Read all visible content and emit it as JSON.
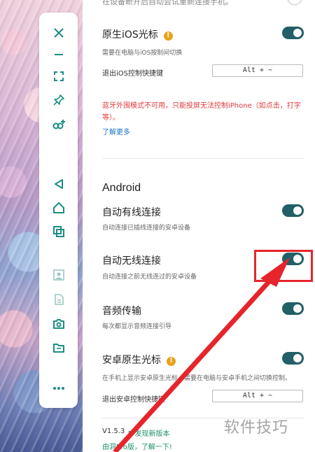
{
  "top_cut_text": "在设备断开后自动尝试重新连接手机。",
  "ios": {
    "native_cursor_title": "原生iOS光标",
    "native_cursor_desc": "需要在电脑与iOS按制间切换",
    "hotkey_label": "退出iOS控制快捷键",
    "hotkey_value": "Alt + ~",
    "warning": "蓝牙外围模式不可用，只能投屏无法控制iPhone（如点击，打字等）。",
    "learn_more": "了解更多"
  },
  "android": {
    "section_title": "Android",
    "auto_wired_title": "自动有线连接",
    "auto_wired_desc": "自动连接已插线连接的安卓设备",
    "auto_wireless_title": "自动无线连接",
    "auto_wireless_desc": "自动连接之前无线连过的安卓设备",
    "audio_title": "音频传输",
    "audio_desc": "每次都显示音频连接引导",
    "native_cursor_title": "安卓原生光标",
    "native_cursor_desc": "在手机上显示安卓原生光标，需要在电脑与安卓手机之间切换控制。",
    "hotkey_label": "退出安卓控制快捷键",
    "hotkey_value": "Alt + ~"
  },
  "footer": {
    "version": "V1.5.3",
    "update_link": "↑ 发现新版本",
    "promo_link": "由洞Pro版，了解一下!"
  },
  "toolbar": {
    "icons": [
      "close-icon",
      "minimize-icon",
      "fullscreen-icon",
      "pin-icon",
      "connect-add-icon",
      "back-icon",
      "home-icon",
      "recent-apps-icon",
      "screenshot-icon",
      "document-icon",
      "camera-icon",
      "folder-icon",
      "more-icon"
    ]
  },
  "watermark": "软件技巧",
  "colors": {
    "accent": "#1b8e86",
    "toggle_on": "#225f66",
    "warning_text": "#e03a3a",
    "link": "#1a73c8",
    "annotation": "#e5252b"
  }
}
